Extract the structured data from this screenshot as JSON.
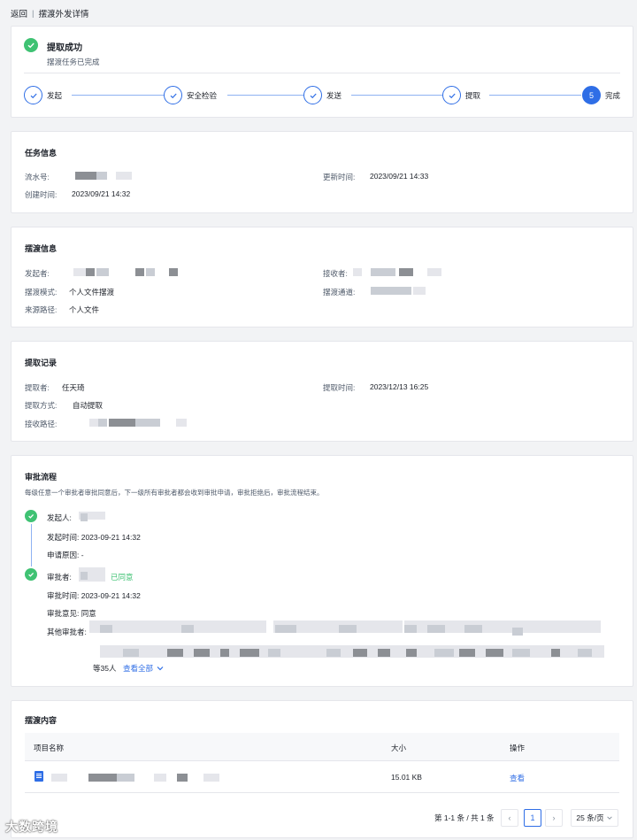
{
  "topbar": {
    "back": "返回",
    "sep": "|",
    "title": "摆渡外发详情"
  },
  "status": {
    "title": "提取成功",
    "subtitle": "摆渡任务已完成"
  },
  "steps": [
    {
      "label": "发起",
      "state": "done"
    },
    {
      "label": "安全检验",
      "state": "done"
    },
    {
      "label": "发送",
      "state": "done"
    },
    {
      "label": "提取",
      "state": "done"
    },
    {
      "label": "完成",
      "state": "current",
      "number": "5"
    }
  ],
  "task_info": {
    "title": "任务信息",
    "serial_label": "流水号:",
    "updated_label": "更新时间:",
    "updated_value": "2023/09/21 14:33",
    "created_label": "创建时间:",
    "created_value": "2023/09/21 14:32"
  },
  "ferry_info": {
    "title": "摆渡信息",
    "initiator_label": "发起者:",
    "receiver_label": "接收者:",
    "mode_label": "摆渡模式:",
    "mode_value": "个人文件摆渡",
    "channel_label": "摆渡通道:",
    "source_label": "来源路径:",
    "source_value": "个人文件"
  },
  "extract_record": {
    "title": "提取记录",
    "extractor_label": "提取者:",
    "extractor_value": "任天琦",
    "time_label": "提取时间:",
    "time_value": "2023/12/13 16:25",
    "method_label": "提取方式:",
    "method_value": "自动提取",
    "path_label": "接收路径:"
  },
  "approval": {
    "title": "审批流程",
    "description": "每级任意一个审批者审批同意后，下一级所有审批者都会收到审批申请，审批拒绝后，审批流程结束。",
    "initiator_label": "发起人:",
    "initiate_time": "发起时间: 2023-09-21 14:32",
    "reason": "申请原因: -",
    "approver_label": "审批者:",
    "approved_status": "已同意",
    "approve_time": "审批时间: 2023-09-21 14:32",
    "opinion": "审批意见: 同意",
    "others_label": "其他审批者:",
    "count": "等35人",
    "view_all": "查看全部"
  },
  "content": {
    "title": "摆渡内容",
    "columns": [
      "项目名称",
      "大小",
      "操作"
    ],
    "rows": [
      {
        "size": "15.01 KB",
        "action": "查看"
      }
    ],
    "pager_summary": "第 1-1 条 / 共 1 条",
    "current_page": "1",
    "page_size": "25 条/页"
  },
  "colors": {
    "primary": "#2f6ee6",
    "success": "#3fc273",
    "border": "#e5e6eb",
    "background": "#f2f3f5"
  },
  "watermark": "大数跨境"
}
